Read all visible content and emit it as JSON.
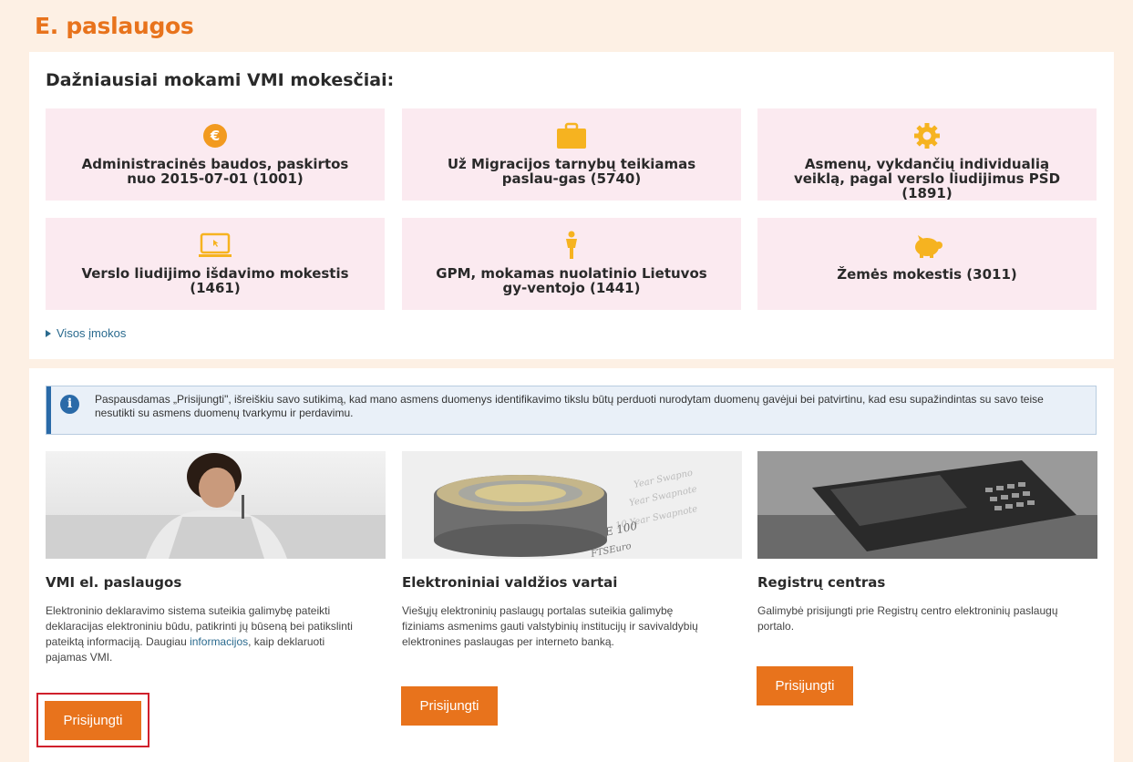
{
  "page_title": "E. paslaugos",
  "taxes": {
    "title": "Dažniausiai mokami VMI mokesčiai:",
    "items": [
      {
        "label": "Administracinės baudos, paskirtos nuo 2015-07-01 (1001)",
        "icon": "euro-coin-icon"
      },
      {
        "label": "Už Migracijos tarnybų teikiamas paslau-gas (5740)",
        "icon": "briefcase-icon"
      },
      {
        "label": "Asmenų, vykdančių individualią veiklą, pagal verslo liudijimus PSD (1891)",
        "icon": "gear-icon"
      },
      {
        "label": "Verslo liudijimo išdavimo mokestis (1461)",
        "icon": "laptop-icon"
      },
      {
        "label": "GPM, mokamas nuolatinio Lietuvos gy-ventojo (1441)",
        "icon": "person-icon"
      },
      {
        "label": "Žemės mokestis (3011)",
        "icon": "piggy-bank-icon"
      }
    ],
    "more_link": "Visos įmokos"
  },
  "notice": "Paspausdamas „Prisijungti\", išreiškiu savo sutikimą, kad mano asmens duomenys identifikavimo tikslu būtų perduoti nurodytam duomenų gavėjui bei patvirtinu, kad esu supažindintas su savo teise nesutikti su asmens duomenų tvarkymu ir perdavimu.",
  "services": [
    {
      "title": "VMI el. paslaugos",
      "desc_before": "Elektroninio deklaravimo sistema suteikia galimybę pateikti deklaracijas elektroniniu būdu, patikrinti jų būseną bei patikslinti pateiktą informaciją. Daugiau ",
      "desc_link": "informacijos",
      "desc_after": ", kaip deklaruoti pajamas VMI.",
      "button": "Prisijungti"
    },
    {
      "title": "Elektroniniai valdžios vartai",
      "desc": "Viešųjų elektroninių paslaugų portalas suteikia galimybę fiziniams asmenims gauti valstybinių institucijų ir savivaldybių elektronines paslaugas per interneto banką.",
      "button": "Prisijungti"
    },
    {
      "title": "Registrų centras",
      "desc": "Galimybė prisijungti prie Registrų centro elektroninių paslaugų portalo.",
      "button": "Prisijungti"
    }
  ],
  "colors": {
    "accent": "#e8731c",
    "tile_bg": "#fbeaf0",
    "highlight": "#d0202c",
    "info": "#2a6aa8"
  }
}
